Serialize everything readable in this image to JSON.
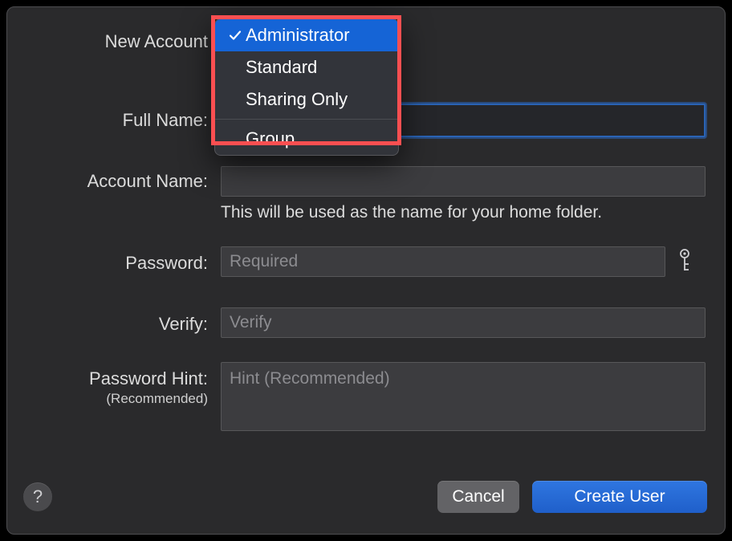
{
  "labels": {
    "new_account": "New Account",
    "full_name": "Full Name:",
    "account_name": "Account Name:",
    "account_name_hint": "This will be used as the name for your home folder.",
    "password": "Password:",
    "verify": "Verify:",
    "password_hint": "Password Hint:",
    "password_hint_sub": "(Recommended)"
  },
  "placeholders": {
    "password": "Required",
    "verify": "Verify",
    "hint": "Hint (Recommended)"
  },
  "dropdown": {
    "options": [
      "Administrator",
      "Standard",
      "Sharing Only",
      "Group"
    ],
    "selected_index": 0
  },
  "buttons": {
    "cancel": "Cancel",
    "create": "Create User",
    "help": "?"
  },
  "icons": {
    "key": "key-icon",
    "check": "checkmark-icon"
  }
}
